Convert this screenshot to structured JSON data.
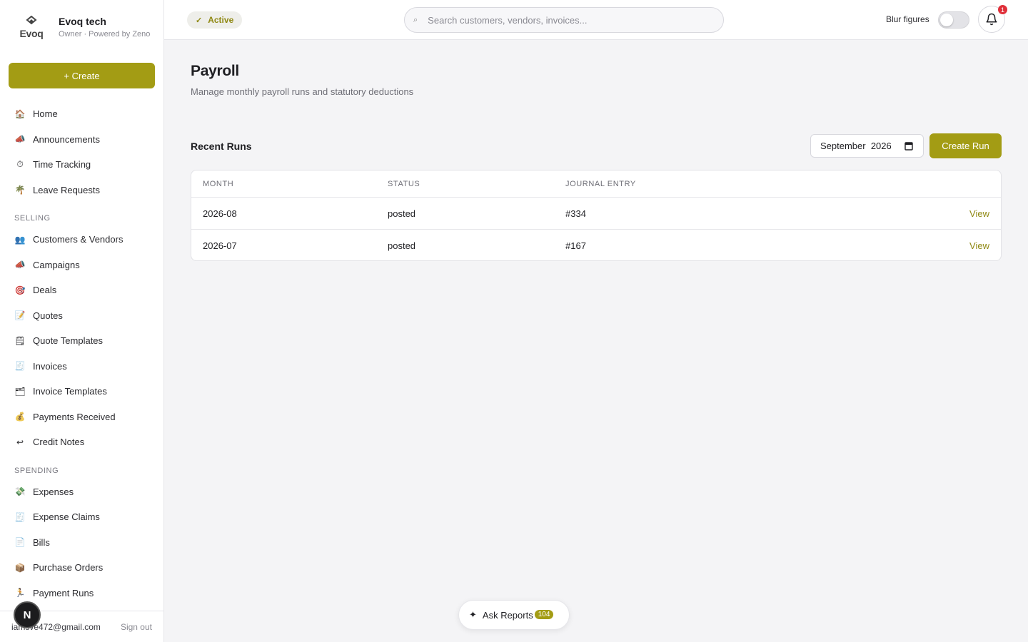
{
  "brand": {
    "logo_text": "Evoq",
    "company": "Evoq tech",
    "role": "Owner · Powered by Zeno"
  },
  "sidebar": {
    "create_label": "+ Create",
    "items": [
      {
        "id": "home",
        "label": "Home",
        "icon": "🏠"
      },
      {
        "id": "announcements",
        "label": "Announcements",
        "icon": "📣"
      },
      {
        "id": "time-tracking",
        "label": "Time Tracking",
        "icon": "⏱"
      },
      {
        "id": "leave-requests",
        "label": "Leave Requests",
        "icon": "🌴"
      }
    ],
    "selling_title": "SELLING",
    "selling": [
      {
        "id": "customers-vendors",
        "label": "Customers & Vendors",
        "icon": "👥"
      },
      {
        "id": "campaigns",
        "label": "Campaigns",
        "icon": "📣"
      },
      {
        "id": "deals",
        "label": "Deals",
        "icon": "🎯"
      },
      {
        "id": "quotes",
        "label": "Quotes",
        "icon": "📝"
      },
      {
        "id": "quote-templates",
        "label": "Quote Templates",
        "icon": "🗒"
      },
      {
        "id": "invoices",
        "label": "Invoices",
        "icon": "🧾"
      },
      {
        "id": "invoice-templates",
        "label": "Invoice Templates",
        "icon": "🗂"
      },
      {
        "id": "payments-received",
        "label": "Payments Received",
        "icon": "💰"
      },
      {
        "id": "credit-notes",
        "label": "Credit Notes",
        "icon": "↩"
      }
    ],
    "spending_title": "SPENDING",
    "spending": [
      {
        "id": "expenses",
        "label": "Expenses",
        "icon": "💸"
      },
      {
        "id": "expense-claims",
        "label": "Expense Claims",
        "icon": "🧾"
      },
      {
        "id": "bills",
        "label": "Bills",
        "icon": "📄"
      },
      {
        "id": "purchase-orders",
        "label": "Purchase Orders",
        "icon": "📦"
      },
      {
        "id": "payment-runs",
        "label": "Payment Runs",
        "icon": "🏃"
      }
    ],
    "user_email": "iamsve472@gmail.com",
    "signout_label": "Sign out",
    "avatar_letter": "N"
  },
  "topbar": {
    "status": "Active",
    "search_placeholder": "Search customers, vendors, invoices...",
    "blur_label": "Blur figures",
    "notification_count": "1"
  },
  "page": {
    "title": "Payroll",
    "subtitle": "Manage monthly payroll runs and statutory deductions",
    "section_title": "Recent Runs",
    "month_value": "September  2026",
    "create_run_label": "Create Run"
  },
  "table": {
    "headers": [
      "MONTH",
      "STATUS",
      "JOURNAL ENTRY"
    ],
    "rows": [
      {
        "month": "2026-08",
        "status": "posted",
        "journal": "#334",
        "action": "View"
      },
      {
        "month": "2026-07",
        "status": "posted",
        "journal": "#167",
        "action": "View"
      }
    ]
  },
  "ask": {
    "label": "Ask Reports",
    "count": "104"
  },
  "colors": {
    "accent": "#a39c14",
    "accent_text": "#8f8812",
    "badge": "#e0303a"
  }
}
